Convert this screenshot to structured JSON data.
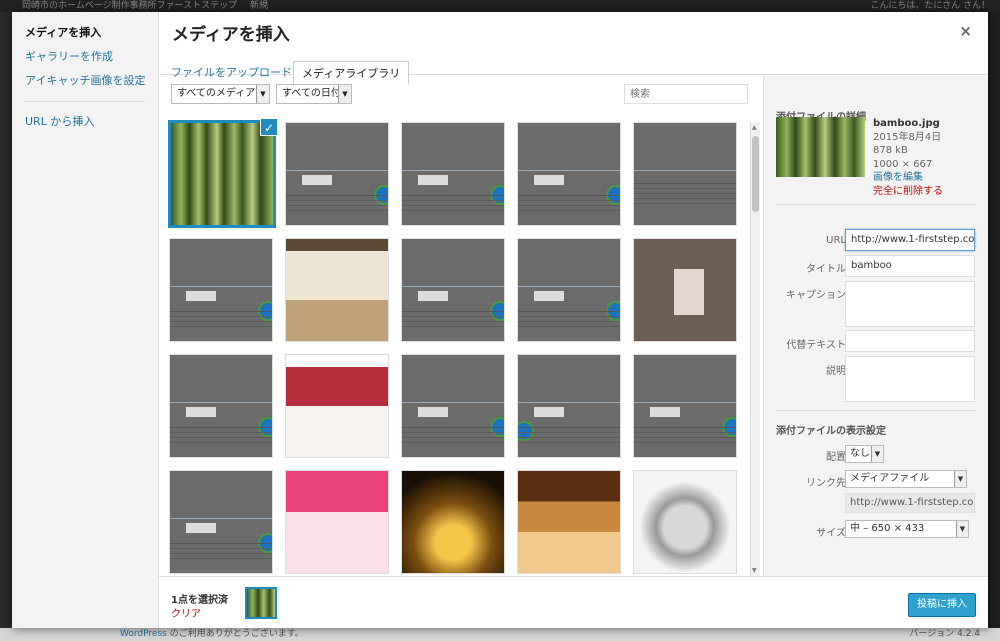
{
  "background": {
    "admin_bar_text": "岡崎市のホームページ制作事務所ファーストステップ",
    "admin_bar_new": "新規",
    "admin_bar_greeting": "こんにちは、たにさん さん！",
    "footer_link": "WordPress",
    "footer_text": " のご利用ありがとうございます。",
    "footer_version": "バージョン 4.2.4"
  },
  "menu": {
    "items": [
      {
        "label": "メディアを挿入"
      },
      {
        "label": "ギャラリーを作成"
      },
      {
        "label": "アイキャッチ画像を設定"
      },
      {
        "label": "URL から挿入"
      }
    ]
  },
  "modal": {
    "title": "メディアを挿入",
    "close_symbol": "×",
    "tabs": [
      {
        "label": "ファイルをアップロード"
      },
      {
        "label": "メディアライブラリ"
      }
    ]
  },
  "toolbar": {
    "filter_media": "すべてのメディア",
    "filter_date": "すべての日付",
    "search_placeholder": "検索"
  },
  "sidebar": {
    "details_heading": "添付ファイルの詳細",
    "file_name": "bamboo.jpg",
    "date": "2015年8月4日",
    "size": "878 kB",
    "dimensions": "1000 × 667",
    "edit_link": "画像を編集",
    "delete_link": "完全に削除する",
    "fields": {
      "url_label": "URL",
      "url_value": "http://www.1-firststep.com/w",
      "title_label": "タイトル",
      "title_value": "bamboo",
      "caption_label": "キャプション",
      "alt_label": "代替テキスト",
      "description_label": "説明"
    },
    "display_heading": "添付ファイルの表示設定",
    "display": {
      "align_label": "配置",
      "align_value": "なし",
      "link_label": "リンク先",
      "link_value": "メディアファイル",
      "link_url": "http://www.1-firststep.com/w",
      "size_label": "サイズ",
      "size_value": "中 – 650 × 433"
    }
  },
  "bottom": {
    "selected_count": "1点を選択済",
    "clear_label": "クリア",
    "insert_button": "投稿に挿入"
  },
  "icons": {
    "checkmark": "✓",
    "dropdown_arrow": "▼",
    "scroll_up": "▲",
    "scroll_down": "▼"
  },
  "colors": {
    "accent": "#1e8cbe",
    "link": "#21759b",
    "danger": "#bc0b0b",
    "primary_button": "#2ea2cc"
  }
}
